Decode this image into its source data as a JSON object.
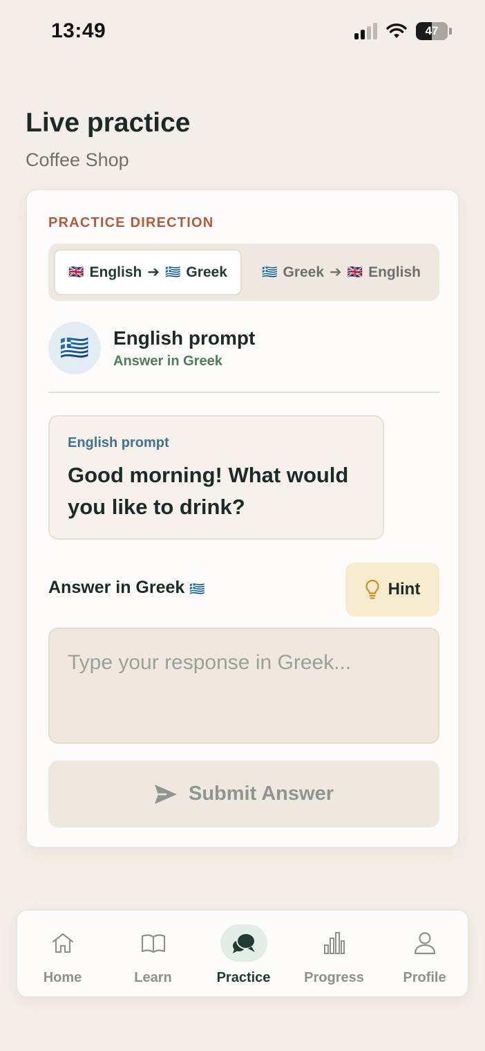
{
  "status_bar": {
    "time": "13:49",
    "battery": "47"
  },
  "header": {
    "title": "Live practice",
    "subtitle": "Coffee Shop"
  },
  "practice_direction": {
    "label": "PRACTICE DIRECTION",
    "options": [
      {
        "from_flag": "🇬🇧",
        "from": "English",
        "arrow": "➔",
        "to_flag": "🇬🇷",
        "to": "Greek",
        "selected": true
      },
      {
        "from_flag": "🇬🇷",
        "from": "Greek",
        "arrow": "➔",
        "to_flag": "🇬🇧",
        "to": "English",
        "selected": false
      }
    ]
  },
  "mode": {
    "avatar_flag": "🇬🇷",
    "title": "English prompt",
    "subtitle": "Answer in Greek"
  },
  "prompt": {
    "label": "English prompt",
    "text": "Good morning! What would you like to drink?"
  },
  "answer": {
    "label": "Answer in Greek",
    "flag": "🇬🇷",
    "hint_label": "Hint",
    "value": "",
    "placeholder": "Type your response in Greek...",
    "submit_label": "Submit Answer"
  },
  "nav": {
    "items": [
      {
        "label": "Home",
        "icon": "home-icon",
        "active": false
      },
      {
        "label": "Learn",
        "icon": "book-icon",
        "active": false
      },
      {
        "label": "Practice",
        "icon": "chat-bubbles-icon",
        "active": true
      },
      {
        "label": "Progress",
        "icon": "bar-chart-icon",
        "active": false
      },
      {
        "label": "Profile",
        "icon": "user-icon",
        "active": false
      }
    ]
  },
  "colors": {
    "accent_terracotta": "#b25a3c",
    "accent_green": "#4f7d5c",
    "accent_blue": "#3f7490",
    "hint_bg": "#f6ebcc",
    "nav_active": "#1f3b33"
  }
}
